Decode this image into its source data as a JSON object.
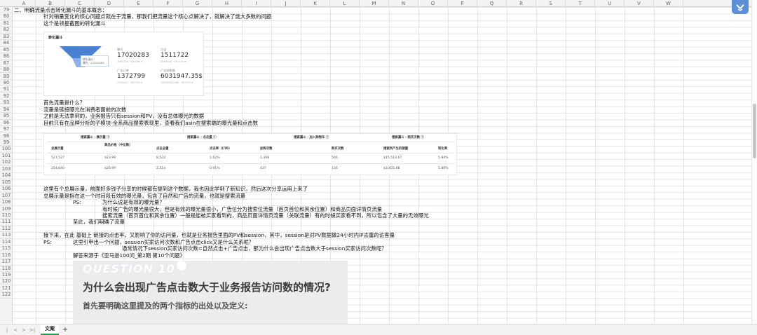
{
  "columns": [
    "A",
    "B",
    "C",
    "D",
    "E",
    "F",
    "G",
    "H",
    "I",
    "J",
    "K",
    "L",
    "M",
    "N",
    "O",
    "P",
    "Q",
    "R",
    "S",
    "T",
    "U",
    "V",
    "W"
  ],
  "rows": [
    "79",
    "80",
    "81",
    "82",
    "83",
    "84",
    "85",
    "86",
    "87",
    "88",
    "89",
    "90",
    "91",
    "92",
    "93",
    "94",
    "95",
    "96",
    "97",
    "98",
    "99",
    "100",
    "101",
    "102",
    "103",
    "104",
    "105",
    "106",
    "107",
    "108",
    "109",
    "110",
    "111",
    "112",
    "113",
    "114",
    "115",
    "116",
    "117",
    "118",
    "119",
    "120",
    "121",
    "122"
  ],
  "cells": {
    "r79": "二、明确流量点击转化漏斗的基本概念：",
    "r80": "针对销量变化的核心问题点就在于流量，那我们把流量这个核心点解决了，就解决了绝大多数的问题",
    "r81": "这个是领星截图的转化漏斗",
    "r92": "首先流量是什么？",
    "r93": "流量是链接曝光在消费者面前的次数",
    "r94": "之前是无法拿到的，业务报告只有session和PV，没有总体曝光的数据",
    "r95": "目前只有在品牌分析的子模块-全系商品搜索表现里，查看我们asin在搜索端的曝光量和点击数",
    "r103": "这里有个总展示量，前面好多钱子分享的时候都有提到这个数据，我也因此学到了新知识，然后这次分享运用上来了",
    "r104": "总展示量是指在这一个时间段有效的曝光量，包含了自然和广告的流量，也就是搜索流量",
    "r105a": "PS:",
    "r105b": "为什么说是有效的曝光量？",
    "r106": "有时候广告的曝光量很大，但是有效的曝光量很小，广告位分为搜索位流量（首页首位和其余位置）和商品页面详情页流量",
    "r107": "搜索流量（首页首位和其余位置）一般是能被买家看到的，商品页面详情页流量（关联流量）有的时候买家看不到，所以包含了大量的无效曝光",
    "r108": "至此，我们明确了流量",
    "r110": "接下来，在此 基础上 链接的点击率，又影响了你的访问量，也就是业务报告里面的PV和session，其中，session是对PV数据做24小时内IP去重的访客量",
    "r111a": "PS:",
    "r111b": "这里引申出一个问题，session买家访问次数和广告点击click又是什么关系呢？",
    "r112": "通常情况下session买家访问次数=自然点击+广告点击，那为什么会出现广告点击数大于session买家访问次数呢？",
    "r113": "解答来源于《亚马逊100问_第2期 第10个问题》"
  },
  "funnel_image": {
    "title": "转化漏斗",
    "tooltip_line1": "转化漏斗：",
    "tooltip_line2": "曝光：17020283",
    "metrics": [
      {
        "label": "曝光",
        "value": "17020283",
        "sub": "2067334 · 49.93% ▾"
      },
      {
        "label": "点击",
        "value": "1511722",
        "sub": "2869306 · 46.77% ▾"
      },
      {
        "label": "广告订单",
        "value": "1372799",
        "sub": "2710227 · 48.79% ▾"
      },
      {
        "label": "广告销售额",
        "value": "6031947.35$",
        "sub": "12072021.888 · 49.97% ▾"
      }
    ]
  },
  "search_table_image": {
    "groups": [
      "搜索漏斗 - 展示量 ⓘ",
      "搜索漏斗 - 点击量 ⓘ",
      "搜索漏斗 - 加入购物车 ⓘ",
      "搜索漏斗 - 购买次数 ⓘ"
    ],
    "headers": [
      "总展示量",
      "商品价格（中位数）",
      "点击总量",
      "点击率（CTR）",
      "加购次数",
      "购买次数",
      "搜索所产生的销量",
      "转化率"
    ],
    "rows": [
      [
        "527,527",
        "$23.99",
        "8,522",
        "1.62%",
        "1,398",
        "506",
        "$15,513.67",
        "5.94%"
      ],
      [
        "254,040",
        "$26.99",
        "2,314",
        "0.91%",
        "437",
        "136",
        "$3,855.88",
        "5.88%"
      ]
    ]
  },
  "question_image": {
    "number": "QUESTION 10",
    "title": "为什么会出现广告点击数大于业务报告访问数的情况?",
    "subtitle": "首先要明确这里提及的两个指标的出处以及定义:"
  },
  "tabs": {
    "nav_first": "|<",
    "nav_prev": "<",
    "nav_next": ">",
    "nav_last": ">|",
    "active_sheet": "文案",
    "add_sheet": "+"
  },
  "colors": {
    "tab_accent": "#2f9a52",
    "app_icon": "#5b8fd9",
    "funnel_blue": "#4a7fd1"
  }
}
